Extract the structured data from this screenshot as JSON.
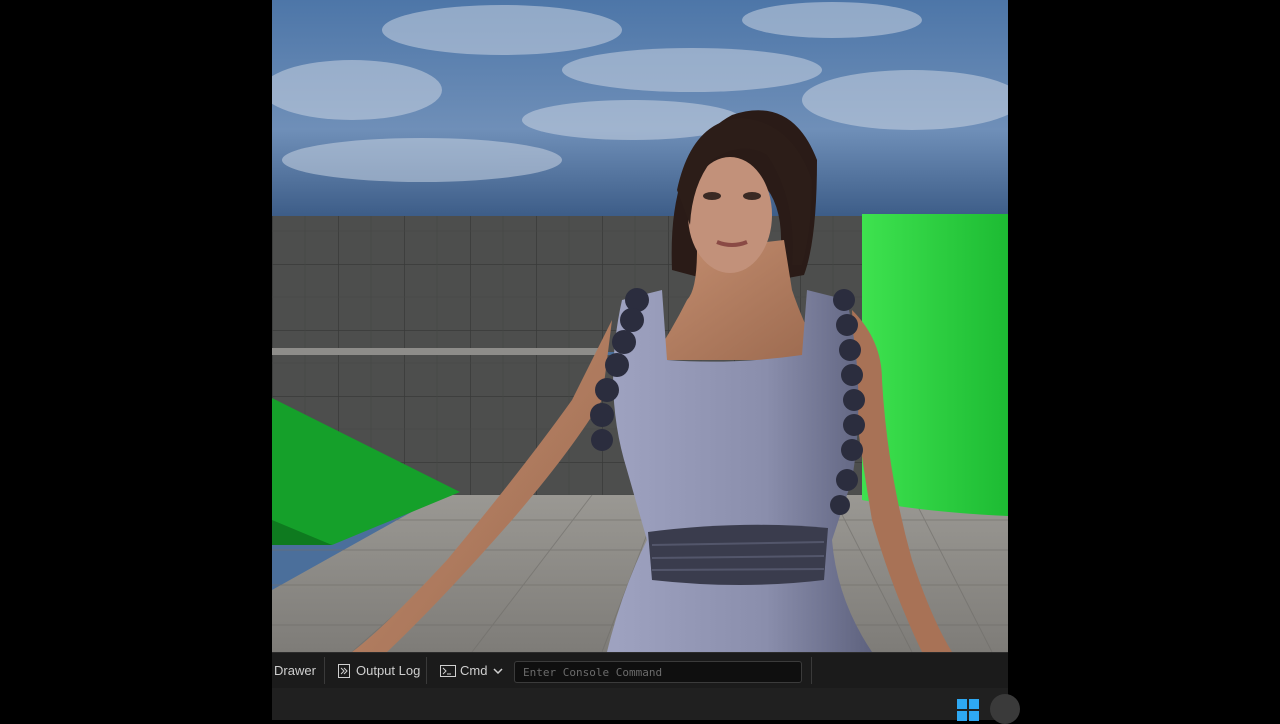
{
  "viewport": {
    "name": "level-viewport",
    "colors": {
      "sky": "#5b7fae",
      "green_block": "#22c43a",
      "wall": "#4a4b4a",
      "floor": "#8d8b87",
      "dress": "#8f93b2"
    }
  },
  "statusbar": {
    "drawer_label": "Drawer",
    "output_log_label": "Output Log",
    "cmd_label": "Cmd",
    "console_placeholder": "Enter Console Command"
  },
  "taskbar": {
    "start_icon": "windows-logo-icon"
  }
}
